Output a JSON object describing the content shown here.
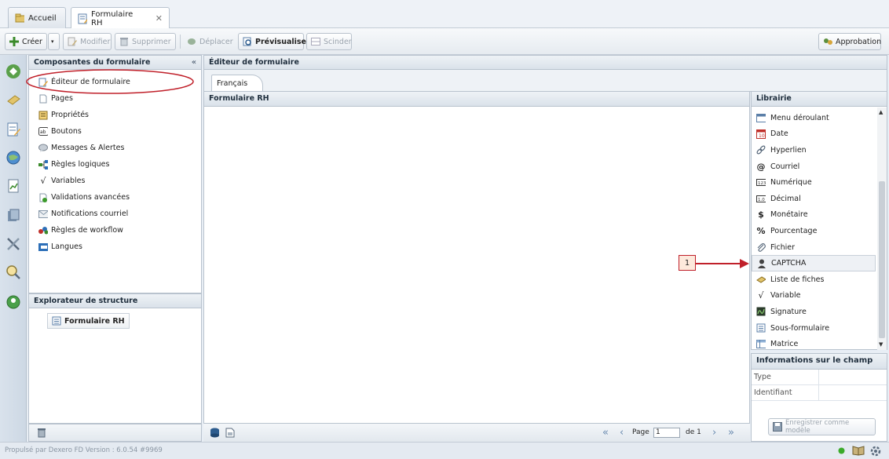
{
  "tabs": {
    "home": "Accueil",
    "form": "Formulaire RH"
  },
  "toolbar": {
    "create": "Créer",
    "modify": "Modifier",
    "delete": "Supprimer",
    "move": "Déplacer",
    "preview": "Prévisualiser",
    "split": "Scinder",
    "approval": "Approbation"
  },
  "components": {
    "title": "Composantes du formulaire",
    "items": [
      "Éditeur de formulaire",
      "Pages",
      "Propriétés",
      "Boutons",
      "Messages & Alertes",
      "Règles logiques",
      "Variables",
      "Validations avancées",
      "Notifications courriel",
      "Règles de workflow",
      "Langues"
    ]
  },
  "explorer": {
    "title": "Explorateur de structure",
    "node": "Formulaire RH"
  },
  "editor": {
    "title": "Éditeur de formulaire",
    "lang_tab": "Français",
    "canvas_title": "Formulaire RH",
    "pager": {
      "page_label": "Page",
      "page_value": "1",
      "of_label": "de 1"
    }
  },
  "library": {
    "title": "Librairie",
    "items": [
      "Menu déroulant",
      "Date",
      "Hyperlien",
      "Courriel",
      "Numérique",
      "Décimal",
      "Monétaire",
      "Pourcentage",
      "Fichier",
      "CAPTCHA",
      "Liste de fiches",
      "Variable",
      "Signature",
      "Sous-formulaire",
      "Matrice"
    ]
  },
  "field_info": {
    "title": "Informations sur le champ",
    "type_label": "Type",
    "id_label": "Identifiant",
    "save_template": "Enregistrer comme modèle"
  },
  "callout": {
    "number": "1"
  },
  "status": {
    "text": "Propulsé par Dexero FD Version : 6.0.54 #9969"
  },
  "colors": {
    "highlight": "#c0202a",
    "accent": "#1f2e3d"
  }
}
